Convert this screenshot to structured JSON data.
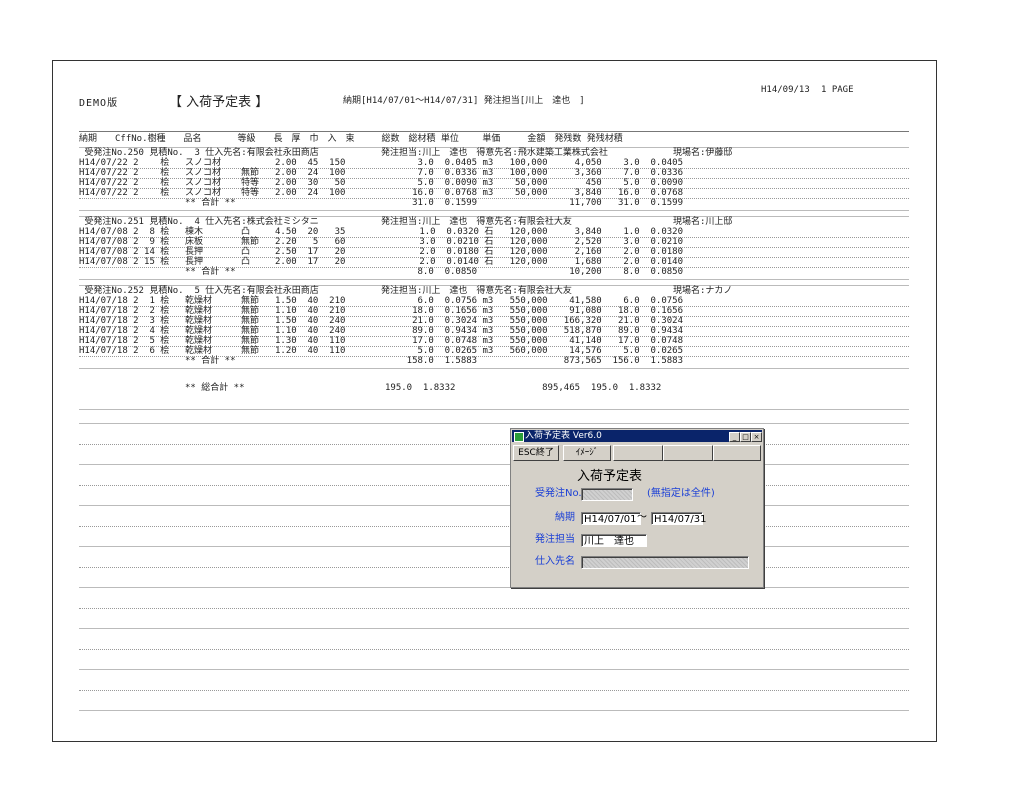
{
  "report": {
    "demo_label": "DEMO版",
    "title": "【 入荷予定表 】",
    "header_info": "納期[H14/07/01～H14/07/31] 発注担当[川上　達也　]",
    "date": "H14/09/13",
    "page": "1 PAGE"
  },
  "columns": {
    "line1": "納期　　CffNo.樹種　　品名　　　　等級　　長　厚　巾　入　束　　　総数　総材積 単位　　 単価　　　金額　発残数 発残材積",
    "line2": "受発注No.   見積No.　　仕入先名"
  },
  "groups": [
    {
      "header": " 受発注No.250 見積No.  3 仕入先名:有限会社永田商店",
      "header_mid": "",
      "header_right": "発注担当:川上　達也　得意先名:飛水建築工業株式会社",
      "site": "現場名:伊藤邸",
      "rows": [
        {
          "left": "H14/07/22 2    桧",
          "name": "スノコ材",
          "grade": "",
          "dims": "2.00  45  150",
          "nums": "3.0  0.0405 m3   100,000     4,050    3.0  0.0405"
        },
        {
          "left": "H14/07/22 2    桧",
          "name": "スノコ材",
          "grade": "無節",
          "dims": "2.00  24  100",
          "nums": "7.0  0.0336 m3   100,000     3,360    7.0  0.0336"
        },
        {
          "left": "H14/07/22 2    桧",
          "name": "スノコ材",
          "grade": "特等",
          "dims": "2.00  30   50",
          "nums": "5.0  0.0090 m3    50,000       450    5.0  0.0090"
        },
        {
          "left": "H14/07/22 2    桧",
          "name": "スノコ材",
          "grade": "特等",
          "dims": "2.00  24  100",
          "nums": "16.0  0.0768 m3    50,000     3,840   16.0  0.0768"
        }
      ],
      "subtotal_label": "** 合計 **",
      "subtotal": "31.0  0.1599                 11,700   31.0  0.1599"
    },
    {
      "header": " 受発注No.251 見積No.  4 仕入先名:株式会社ミシタニ",
      "header_right": "発注担当:川上　達也　得意先名:有限会社大友",
      "site": "現場名:川上邸",
      "rows": [
        {
          "left": "H14/07/08 2  8 桧",
          "name": "棟木",
          "grade": "凸",
          "dims": "4.50  20   35",
          "nums": "1.0  0.0320 石   120,000     3,840    1.0  0.0320"
        },
        {
          "left": "H14/07/08 2  9 桧",
          "name": "床板",
          "grade": "無節",
          "dims": "2.20   5   60",
          "nums": "3.0  0.0210 石   120,000     2,520    3.0  0.0210"
        },
        {
          "left": "H14/07/08 2 14 桧",
          "name": "長押",
          "grade": "凸",
          "dims": "2.50  17   20",
          "nums": "2.0  0.0180 石   120,000     2,160    2.0  0.0180"
        },
        {
          "left": "H14/07/08 2 15 桧",
          "name": "長押",
          "grade": "凸",
          "dims": "2.00  17   20",
          "nums": "2.0  0.0140 石   120,000     1,680    2.0  0.0140"
        }
      ],
      "subtotal_label": "** 合計 **",
      "subtotal": "8.0  0.0850                 10,200    8.0  0.0850"
    },
    {
      "header": " 受発注No.252 見積No.  5 仕入先名:有限会社永田商店",
      "header_right": "発注担当:川上　達也　得意先名:有限会社大友",
      "site": "現場名:ナカノ",
      "rows": [
        {
          "left": "H14/07/18 2  1 桧",
          "name": "乾燥材",
          "grade": "無節",
          "dims": "1.50  40  210",
          "nums": "6.0  0.0756 m3   550,000    41,580    6.0  0.0756"
        },
        {
          "left": "H14/07/18 2  2 桧",
          "name": "乾燥材",
          "grade": "無節",
          "dims": "1.10  40  210",
          "nums": "18.0  0.1656 m3   550,000    91,080   18.0  0.1656"
        },
        {
          "left": "H14/07/18 2  3 桧",
          "name": "乾燥材",
          "grade": "無節",
          "dims": "1.50  40  240",
          "nums": "21.0  0.3024 m3   550,000   166,320   21.0  0.3024"
        },
        {
          "left": "H14/07/18 2  4 桧",
          "name": "乾燥材",
          "grade": "無節",
          "dims": "1.10  40  240",
          "nums": "89.0  0.9434 m3   550,000   518,870   89.0  0.9434"
        },
        {
          "left": "H14/07/18 2  5 桧",
          "name": "乾燥材",
          "grade": "無節",
          "dims": "1.30  40  110",
          "nums": "17.0  0.0748 m3   550,000    41,140   17.0  0.0748"
        },
        {
          "left": "H14/07/18 2  6 桧",
          "name": "乾燥材",
          "grade": "無節",
          "dims": "1.20  40  110",
          "nums": "5.0  0.0265 m3   560,000    14,576    5.0  0.0265"
        }
      ],
      "subtotal_label": "** 合計 **",
      "subtotal": "158.0  1.5883                873,565  156.0  1.5883"
    }
  ],
  "grand_total": {
    "label": "** 総合計 **",
    "values": "195.0  1.8332                895,465  195.0  1.8332"
  },
  "dialog": {
    "title": "入荷予定表 Ver6.0",
    "btn_minimize": "_",
    "btn_maximize": "□",
    "btn_close": "×",
    "esc_button": "ESC終了",
    "image_button": "ｲﾒｰｼﾞ",
    "heading": "入荷予定表",
    "order_no_label": "受発注No.",
    "order_no_value": "",
    "order_no_hint": "(無指定は全件)",
    "date_label": "納期",
    "date_from": "H14/07/01",
    "date_sep": "～",
    "date_to": "H14/07/31",
    "staff_label": "発注担当",
    "staff_value": "川上　達也",
    "supplier_label": "仕入先名",
    "supplier_value": ""
  }
}
